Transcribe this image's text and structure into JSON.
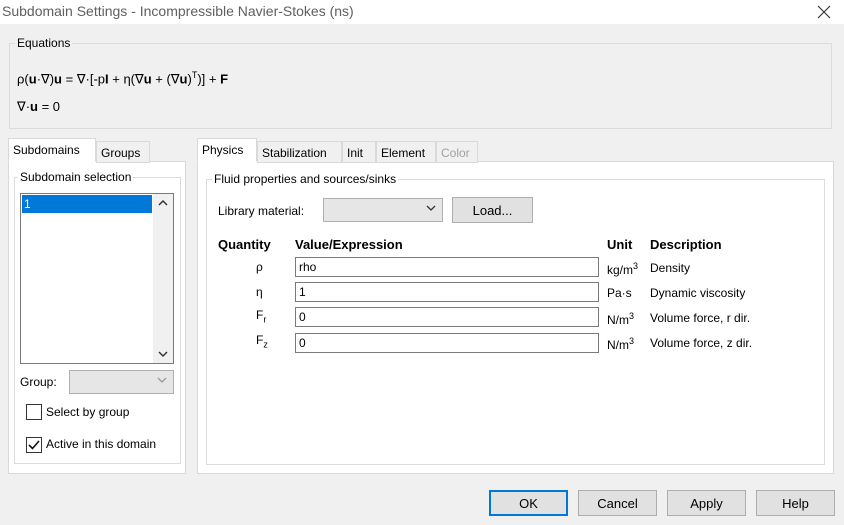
{
  "window": {
    "title": "Subdomain Settings - Incompressible Navier-Stokes (ns)"
  },
  "equations": {
    "legend": "Equations",
    "eq1": {
      "a": "ρ(",
      "b": "u",
      "c": "·∇)",
      "d": "u",
      "e": " = ∇·[-p",
      "f": "I",
      "g": " + η(∇",
      "h": "u",
      "i": " + (∇",
      "j": "u",
      "k": ")",
      "sup": "T",
      "l": ")] + ",
      "m": "F"
    },
    "eq2": {
      "a": "∇·",
      "b": "u",
      "c": " = 0"
    }
  },
  "left_tabs": [
    {
      "label": "Subdomains"
    },
    {
      "label": "Groups"
    }
  ],
  "subdomain_selection": {
    "legend": "Subdomain selection",
    "items": [
      "1"
    ],
    "group_label": "Group:",
    "select_by_group": {
      "label": "Select by group",
      "checked": false
    },
    "active_in_domain": {
      "label": "Active in this domain",
      "checked": true
    }
  },
  "right_tabs": [
    {
      "label": "Physics"
    },
    {
      "label": "Stabilization"
    },
    {
      "label": "Init"
    },
    {
      "label": "Element"
    },
    {
      "label": "Color"
    }
  ],
  "fluid": {
    "legend": "Fluid properties and sources/sinks",
    "library_label": "Library material:",
    "load_button": "Load...",
    "headers": {
      "quantity": "Quantity",
      "value": "Value/Expression",
      "unit": "Unit",
      "description": "Description"
    },
    "rows": [
      {
        "symbol": "ρ",
        "sub": "",
        "value": "rho",
        "unit": "kg/m",
        "unit_sup": "3",
        "description": "Density"
      },
      {
        "symbol": "η",
        "sub": "",
        "value": "1",
        "unit": "Pa·s",
        "unit_sup": "",
        "description": "Dynamic viscosity"
      },
      {
        "symbol": "F",
        "sub": "r",
        "value": "0",
        "unit": "N/m",
        "unit_sup": "3",
        "description": "Volume force, r dir."
      },
      {
        "symbol": "F",
        "sub": "z",
        "value": "0",
        "unit": "N/m",
        "unit_sup": "3",
        "description": "Volume force, z dir."
      }
    ]
  },
  "buttons": {
    "ok": "OK",
    "cancel": "Cancel",
    "apply": "Apply",
    "help": "Help"
  }
}
